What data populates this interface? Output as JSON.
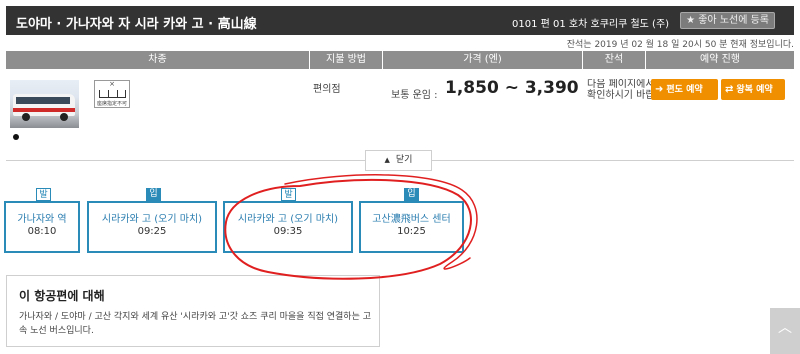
{
  "header": {
    "route_title": "도야마 · 가나자와 자 시라 카와 고 · 高山線",
    "service_info": "0101 편 01 호차  호쿠리쿠 철도 (주)",
    "favorite_label": "★ 좋아 노선에 등록"
  },
  "notice": "잔석는 2019 년 02 월 18 일 20시 50 분 현재 정보입니다.",
  "table": {
    "headers": [
      "차종",
      "지불 방법",
      "가격 (엔)",
      "잔석",
      "예약 진행"
    ]
  },
  "vehicle": {
    "seat_badge_mark": "×",
    "seat_badge_text": "座席指定不可"
  },
  "payment": "편의점",
  "fare": {
    "label": "보통 운임 :",
    "value": "1,850 ~ 3,390"
  },
  "seat_info": "다음 페이지에서 확인하시기 바랍",
  "buttons": {
    "oneway": "편도 예약",
    "roundtrip": "왕복 예약",
    "close": "닫기"
  },
  "stops": [
    {
      "tag": "발",
      "name": "가나자와 역",
      "time": "08:10"
    },
    {
      "tag": "입",
      "name": "시라카와 고 (오기 마치)",
      "time": "09:25"
    },
    {
      "tag": "발",
      "name": "시라카와 고 (오기 마치)",
      "time": "09:35"
    },
    {
      "tag": "입",
      "name": "고산濃飛버스 센터",
      "time": "10:25"
    }
  ],
  "about": {
    "heading": "이 항공편에 대해",
    "description": "가나자와 / 도야마 / 고산 각지와 세계 유산 '시라카와 고'갓 쇼즈 쿠리 마을을 직접 연결하는 고속 노선 버스입니다."
  },
  "colors": {
    "header_bg": "#333333",
    "table_head_bg": "#8e8e8e",
    "accent_orange": "#f08f00",
    "stop_blue": "#2a8ab8",
    "annotation_red": "#e02020"
  }
}
